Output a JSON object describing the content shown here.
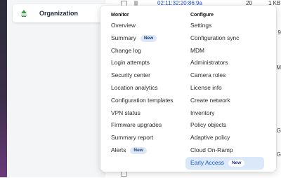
{
  "sidebar": {
    "org_label": "Organization",
    "icon": "organization-icon"
  },
  "background_table": {
    "rows": [
      {
        "mac": "02:11:32:20:86:9a",
        "count": "20",
        "size": "1 KB"
      },
      {
        "right": "9"
      },
      {
        "right": "4 M"
      },
      {
        "right": "3 G"
      },
      {
        "right": "3 G"
      }
    ]
  },
  "menu": {
    "monitor": {
      "heading": "Monitor",
      "items": [
        {
          "label": "Overview",
          "badge": ""
        },
        {
          "label": "Summary",
          "badge": "New"
        },
        {
          "label": "Change log",
          "badge": ""
        },
        {
          "label": "Login attempts",
          "badge": ""
        },
        {
          "label": "Security center",
          "badge": ""
        },
        {
          "label": "Location analytics",
          "badge": ""
        },
        {
          "label": "Configuration templates",
          "badge": ""
        },
        {
          "label": "VPN status",
          "badge": ""
        },
        {
          "label": "Firmware upgrades",
          "badge": ""
        },
        {
          "label": "Summary report",
          "badge": ""
        },
        {
          "label": "Alerts",
          "badge": "New"
        }
      ]
    },
    "configure": {
      "heading": "Configure",
      "items": [
        {
          "label": "Settings",
          "badge": ""
        },
        {
          "label": "Configuration sync",
          "badge": ""
        },
        {
          "label": "MDM",
          "badge": ""
        },
        {
          "label": "Administrators",
          "badge": ""
        },
        {
          "label": "Camera roles",
          "badge": ""
        },
        {
          "label": "License info",
          "badge": ""
        },
        {
          "label": "Create network",
          "badge": ""
        },
        {
          "label": "Inventory",
          "badge": ""
        },
        {
          "label": "Policy objects",
          "badge": ""
        },
        {
          "label": "Adaptive policy",
          "badge": ""
        },
        {
          "label": "Cloud On-Ramp",
          "badge": ""
        },
        {
          "label": "Early Access",
          "badge": "New"
        }
      ]
    }
  },
  "colors": {
    "accent": "#1b5fc1",
    "active_bg": "#dbe8f9",
    "badge_bg": "#dde7f6"
  }
}
